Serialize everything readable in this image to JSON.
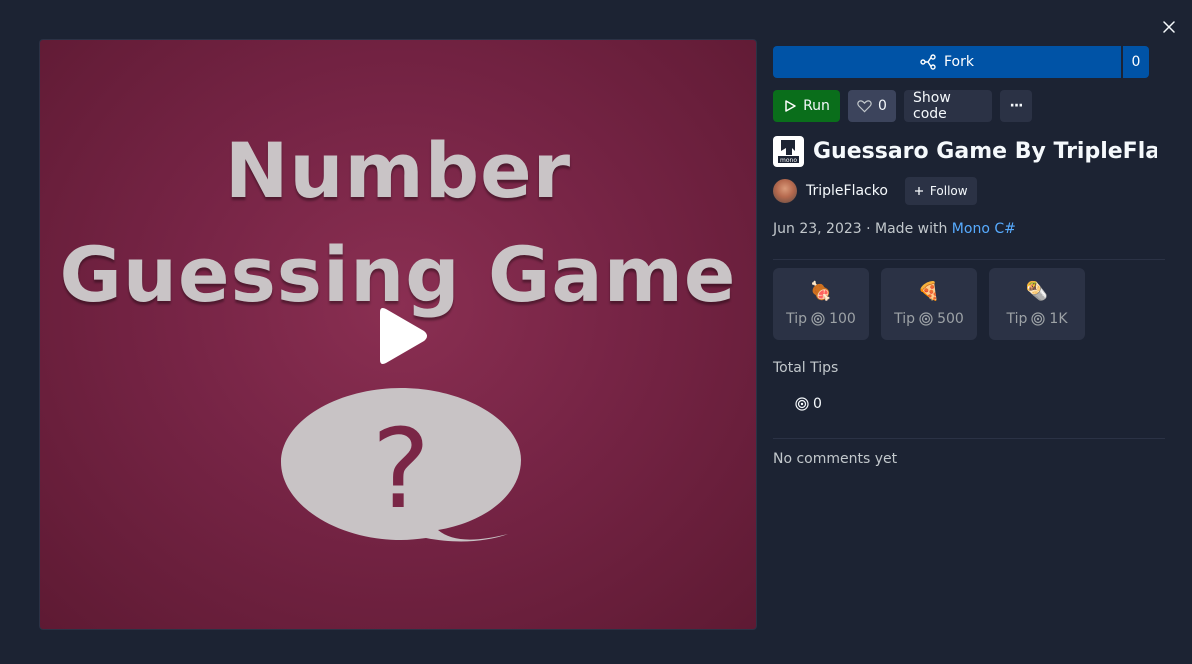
{
  "cover": {
    "line1": "Number",
    "line2": "Guessing Game",
    "symbol": "?"
  },
  "actions": {
    "fork_label": "Fork",
    "fork_count": "0",
    "run_label": "Run",
    "like_count": "0",
    "show_code_label": "Show code",
    "more_label": "···"
  },
  "repl": {
    "icon_text": "mono",
    "title": "Guessaro Game By TripleFlacko"
  },
  "author": {
    "name": "TripleFlacko",
    "follow_label": "Follow"
  },
  "meta": {
    "date": "Jun 23, 2023",
    "separator": " · Made with ",
    "language": "Mono C#"
  },
  "tips": [
    {
      "label": "Tip",
      "amount": "100",
      "emoji": "🍖"
    },
    {
      "label": "Tip",
      "amount": "500",
      "emoji": "🍕"
    },
    {
      "label": "Tip",
      "amount": "1K",
      "emoji": "🌯"
    }
  ],
  "total_tips": {
    "label": "Total Tips",
    "value": "0"
  },
  "comments": {
    "empty_text": "No comments yet"
  },
  "colors": {
    "background": "#1c2333",
    "fork": "#0053a6",
    "run": "#0a6e1b",
    "link": "#57abff",
    "cover": "#762445"
  }
}
